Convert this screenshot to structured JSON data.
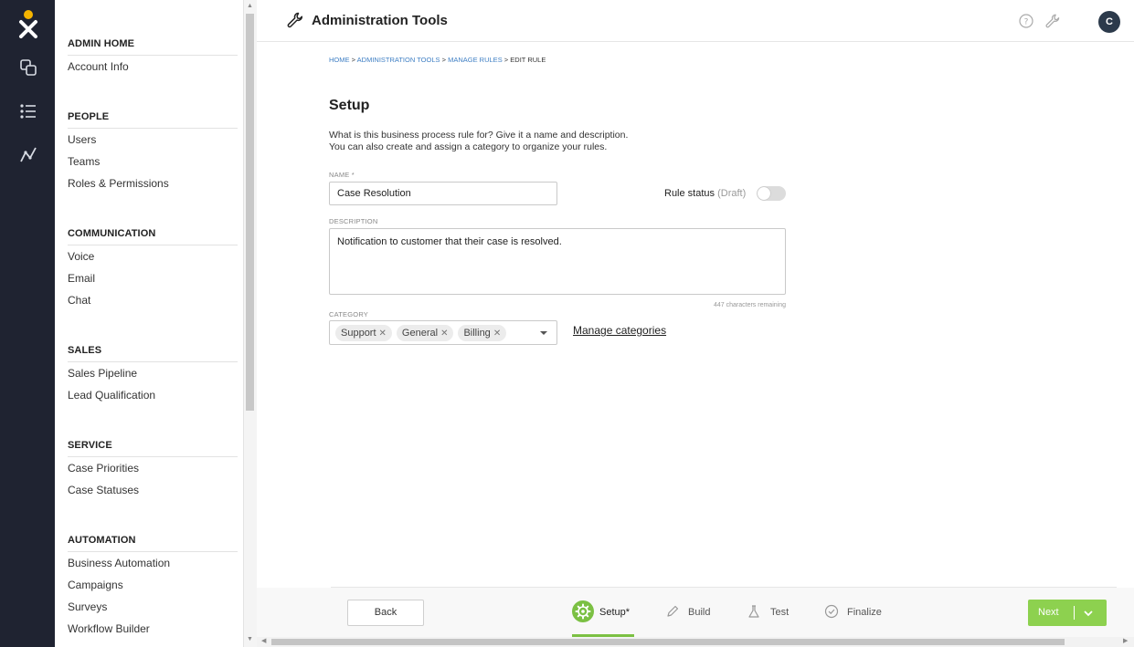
{
  "app": {
    "title": "Administration Tools",
    "avatar_initial": "C"
  },
  "rail": {
    "icons": [
      "logo-icon",
      "layers-icon",
      "list-icon",
      "analytics-icon"
    ]
  },
  "sidebar": {
    "sections": [
      {
        "title": "ADMIN HOME",
        "items": [
          "Account Info"
        ]
      },
      {
        "title": "PEOPLE",
        "items": [
          "Users",
          "Teams",
          "Roles & Permissions"
        ]
      },
      {
        "title": "COMMUNICATION",
        "items": [
          "Voice",
          "Email",
          "Chat"
        ]
      },
      {
        "title": "SALES",
        "items": [
          "Sales Pipeline",
          "Lead Qualification"
        ]
      },
      {
        "title": "SERVICE",
        "items": [
          "Case Priorities",
          "Case Statuses"
        ]
      },
      {
        "title": "AUTOMATION",
        "items": [
          "Business Automation",
          "Campaigns",
          "Surveys",
          "Workflow Builder"
        ]
      }
    ]
  },
  "breadcrumb": {
    "home": "HOME",
    "admin": "ADMINISTRATION TOOLS",
    "rules": "MANAGE RULES",
    "current": "EDIT RULE",
    "sep": ">"
  },
  "setup": {
    "heading": "Setup",
    "description_line1": "What is this business process rule for? Give it a name and description.",
    "description_line2": "You can also create and assign a category to organize your rules."
  },
  "form": {
    "name_label": "NAME *",
    "name_value": "Case Resolution",
    "rule_status_label": "Rule status",
    "rule_status_state": "(Draft)",
    "rule_status_on": false,
    "description_label": "DESCRIPTION",
    "description_value": "Notification to customer that their case is resolved.",
    "chars_remaining": "447 characters remaining",
    "category_label": "CATEGORY",
    "categories": [
      "Support",
      "General",
      "Billing"
    ],
    "manage_categories": "Manage categories"
  },
  "footer": {
    "back_label": "Back",
    "steps": [
      {
        "label": "Setup*",
        "icon": "gear-icon",
        "active": true
      },
      {
        "label": "Build",
        "icon": "pencil-icon",
        "active": false
      },
      {
        "label": "Test",
        "icon": "flask-icon",
        "active": false
      },
      {
        "label": "Finalize",
        "icon": "check-circle-icon",
        "active": false
      }
    ],
    "next_label": "Next"
  },
  "colors": {
    "rail": "#1f2331",
    "accent_green": "#8dd14f",
    "link_blue": "#3f7fc4",
    "logo_yellow": "#f5b400"
  }
}
